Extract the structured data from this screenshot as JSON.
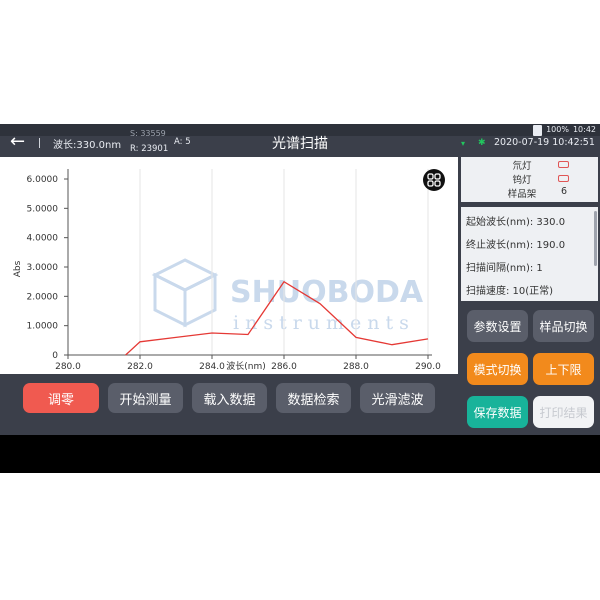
{
  "status_bar": {
    "battery": "100%",
    "time": "10:42"
  },
  "header": {
    "wavelength": "波长:330.0nm",
    "s_value": "S: 33559",
    "r_value": "R: 23901",
    "a_value": "A: 5",
    "title": "光谱扫描",
    "datetime": "2020-07-19 10:42:51"
  },
  "lamps": {
    "deuterium_label": "氘灯",
    "tungsten_label": "钨灯",
    "sample_holder_label": "样品架",
    "sample_holder_value": "6"
  },
  "params": [
    "起始波长(nm): 330.0",
    "终止波长(nm): 190.0",
    "扫描间隔(nm): 1",
    "扫描速度: 10(正常)"
  ],
  "right_buttons": {
    "param_settings": "参数设置",
    "sample_switch": "样品切换",
    "mode_switch": "模式切换",
    "limits": "上下限",
    "save_data": "保存数据",
    "print_result": "打印结果"
  },
  "bottom_buttons": {
    "zero": "调零",
    "start_measure": "开始测量",
    "load_data": "载入数据",
    "data_search": "数据检索",
    "smooth_filter": "光滑滤波"
  },
  "watermark": {
    "brand": "SHUOBODA",
    "sub": "instruments"
  },
  "chart_data": {
    "type": "line",
    "xlabel": "波长(nm)",
    "ylabel": "Abs",
    "xlim": [
      280.0,
      290.0
    ],
    "ylim": [
      0,
      6.0
    ],
    "x_ticks": [
      "280.0",
      "282.0",
      "284.0",
      "286.0",
      "288.0",
      "290.0"
    ],
    "y_ticks": [
      "0",
      "1.0000",
      "2.0000",
      "3.0000",
      "4.0000",
      "5.0000",
      "6.0000"
    ],
    "series": [
      {
        "color": "#e53935",
        "x": [
          281.6,
          282.0,
          283.0,
          284.0,
          285.0,
          286.0,
          287.0,
          288.0,
          289.0,
          290.0
        ],
        "y": [
          0.0,
          0.45,
          0.6,
          0.75,
          0.7,
          2.5,
          1.75,
          0.6,
          0.35,
          0.55
        ]
      }
    ]
  }
}
